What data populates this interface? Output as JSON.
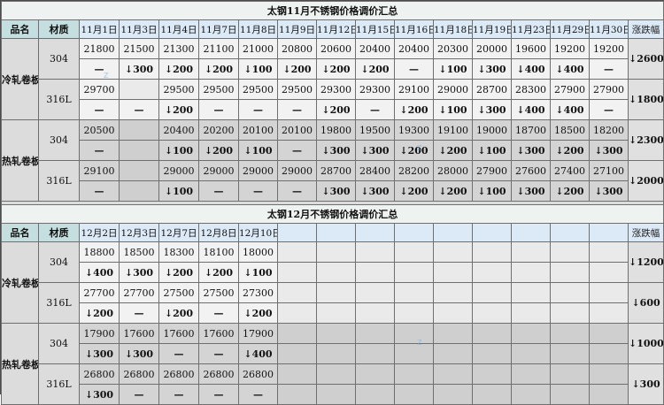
{
  "nov": {
    "title": "太钢11月不锈钢价格调价汇总",
    "col_product": "品名",
    "col_material": "材质",
    "col_range": "涨跌幅",
    "dates": [
      "11月1日",
      "11月3日",
      "11月4日",
      "11月7日",
      "11月8日",
      "11月9日",
      "11月12日",
      "11月15日",
      "11月16日",
      "11月18日",
      "11月19日",
      "11月23日",
      "11月29日",
      "11月30日"
    ],
    "groups": [
      {
        "product": "冷轧卷板",
        "materials": [
          {
            "material": "304",
            "prices": [
              "21800",
              "21500",
              "21300",
              "21100",
              "21000",
              "20800",
              "20600",
              "20400",
              "20400",
              "20300",
              "20000",
              "19600",
              "19200",
              "19200"
            ],
            "changes": [
              "—",
              "↓300",
              "↓200",
              "↓200",
              "↓100",
              "↓200",
              "↓200",
              "↓200",
              "—",
              "↓100",
              "↓300",
              "↓400",
              "↓400",
              "—"
            ],
            "range": "↓2600"
          },
          {
            "material": "316L",
            "prices": [
              "29700",
              "",
              "29500",
              "29500",
              "29500",
              "29500",
              "29300",
              "29300",
              "29100",
              "29000",
              "28700",
              "28300",
              "27900",
              "27900"
            ],
            "changes": [
              "—",
              "—",
              "↓200",
              "—",
              "—",
              "—",
              "↓200",
              "—",
              "↓200",
              "↓100",
              "↓300",
              "↓400",
              "↓400",
              "—"
            ],
            "range": "↓1800"
          }
        ]
      },
      {
        "product": "热轧卷板",
        "materials": [
          {
            "material": "304",
            "prices": [
              "20500",
              "",
              "20400",
              "20200",
              "20100",
              "20100",
              "19800",
              "19500",
              "19300",
              "19100",
              "19000",
              "18700",
              "18500",
              "18200"
            ],
            "changes": [
              "—",
              "",
              "↓100",
              "↓200",
              "↓100",
              "—",
              "↓300",
              "↓300",
              "↓200",
              "↓200",
              "↓100",
              "↓300",
              "↓200",
              "↓300"
            ],
            "range": "↓2300"
          },
          {
            "material": "316L",
            "prices": [
              "29100",
              "",
              "29000",
              "29000",
              "29000",
              "29000",
              "28700",
              "28400",
              "28200",
              "28000",
              "27900",
              "27600",
              "27400",
              "27100"
            ],
            "changes": [
              "—",
              "",
              "↓100",
              "—",
              "—",
              "—",
              "↓300",
              "↓300",
              "↓200",
              "↓200",
              "↓100",
              "↓300",
              "↓200",
              "↓300"
            ],
            "range": "↓2000"
          }
        ]
      }
    ]
  },
  "dec": {
    "title": "太钢12月不锈钢价格调价汇总",
    "col_product": "品名",
    "col_material": "材质",
    "col_range": "涨跌幅",
    "dates": [
      "12月2日",
      "12月3日",
      "12月7日",
      "12月8日",
      "12月10日",
      "",
      "",
      "",
      "",
      "",
      "",
      "",
      "",
      ""
    ],
    "groups": [
      {
        "product": "冷轧卷板",
        "materials": [
          {
            "material": "304",
            "prices": [
              "18800",
              "18500",
              "18300",
              "18100",
              "18000",
              "",
              "",
              "",
              "",
              "",
              "",
              "",
              "",
              ""
            ],
            "changes": [
              "↓400",
              "↓300",
              "↓200",
              "↓200",
              "↓100",
              "",
              "",
              "",
              "",
              "",
              "",
              "",
              "",
              ""
            ],
            "range": "↓1200"
          },
          {
            "material": "316L",
            "prices": [
              "27700",
              "27700",
              "27500",
              "27500",
              "27300",
              "",
              "",
              "",
              "",
              "",
              "",
              "",
              "",
              ""
            ],
            "changes": [
              "↓200",
              "—",
              "↓200",
              "—",
              "↓200",
              "",
              "",
              "",
              "",
              "",
              "",
              "",
              "",
              ""
            ],
            "range": "↓600"
          }
        ]
      },
      {
        "product": "热轧卷板",
        "materials": [
          {
            "material": "304",
            "prices": [
              "17900",
              "17600",
              "17600",
              "17600",
              "17900",
              "",
              "",
              "",
              "",
              "",
              "",
              "",
              "",
              ""
            ],
            "changes": [
              "↓300",
              "↓300",
              "—",
              "—",
              "↓400",
              "",
              "",
              "",
              "",
              "",
              "",
              "",
              "",
              ""
            ],
            "range": "↓1000"
          },
          {
            "material": "316L",
            "prices": [
              "26800",
              "26800",
              "26800",
              "26800",
              "26800",
              "",
              "",
              "",
              "",
              "",
              "",
              "",
              "",
              ""
            ],
            "changes": [
              "↓300",
              "—",
              "—",
              "—",
              "—",
              "",
              "",
              "",
              "",
              "",
              "",
              "",
              "",
              ""
            ],
            "range": "↓300"
          }
        ]
      }
    ]
  }
}
